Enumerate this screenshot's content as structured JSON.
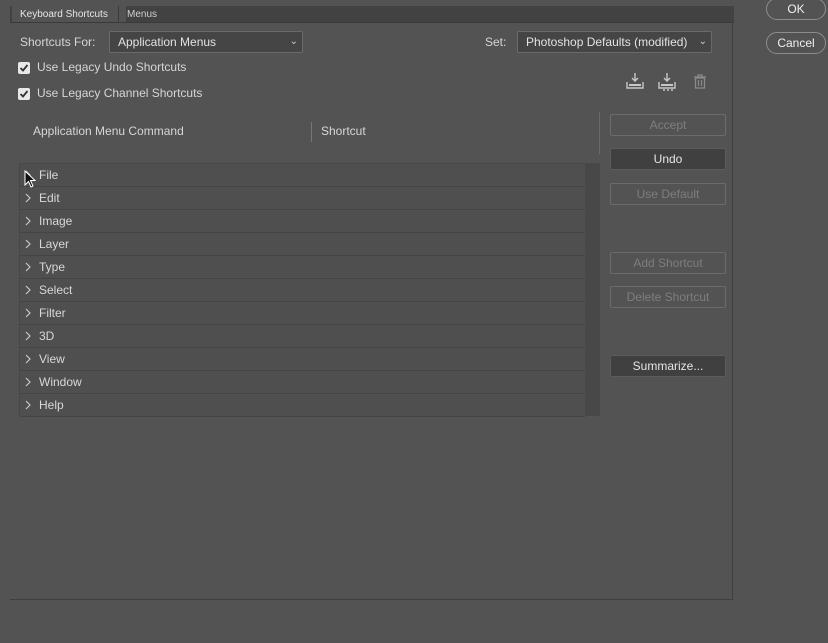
{
  "tabs": [
    {
      "label": "Keyboard Shortcuts",
      "active": true
    },
    {
      "label": "Menus",
      "active": false
    }
  ],
  "shortcuts_for": {
    "label": "Shortcuts For:",
    "value": "Application Menus"
  },
  "set": {
    "label": "Set:",
    "value": "Photoshop Defaults (modified)"
  },
  "options": [
    {
      "label": "Use Legacy Undo Shortcuts",
      "checked": true
    },
    {
      "label": "Use Legacy Channel Shortcuts",
      "checked": true
    }
  ],
  "icons": [
    "save-set-icon",
    "save-set-as-icon",
    "delete-set-icon"
  ],
  "columns": {
    "command": "Application Menu Command",
    "shortcut": "Shortcut"
  },
  "menu_items": [
    "File",
    "Edit",
    "Image",
    "Layer",
    "Type",
    "Select",
    "Filter",
    "3D",
    "View",
    "Window",
    "Help"
  ],
  "buttons": {
    "accept": "Accept",
    "undo": "Undo",
    "use_default": "Use Default",
    "add_shortcut": "Add Shortcut",
    "delete_shortcut": "Delete Shortcut",
    "summarize": "Summarize..."
  },
  "dialog": {
    "ok": "OK",
    "cancel": "Cancel"
  }
}
